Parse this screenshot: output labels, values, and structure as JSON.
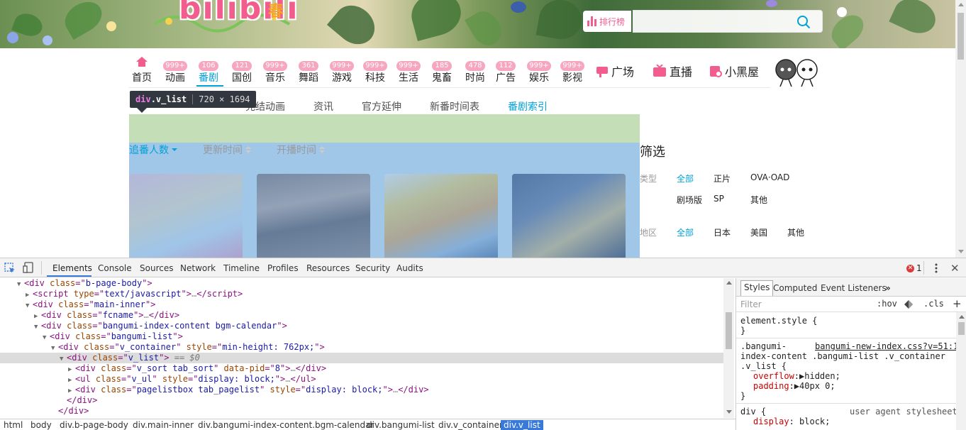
{
  "header": {
    "logo_text": "bilibili",
    "logo_badge": "春",
    "rank_label": "排行榜",
    "search_placeholder": ""
  },
  "nav": {
    "items": [
      {
        "label": "首页",
        "badge": ""
      },
      {
        "label": "动画",
        "badge": "999+"
      },
      {
        "label": "番剧",
        "badge": "106",
        "active": true
      },
      {
        "label": "国创",
        "badge": "121"
      },
      {
        "label": "音乐",
        "badge": "999+"
      },
      {
        "label": "舞蹈",
        "badge": "361"
      },
      {
        "label": "游戏",
        "badge": "999+"
      },
      {
        "label": "科技",
        "badge": "999+"
      },
      {
        "label": "生活",
        "badge": "999+"
      },
      {
        "label": "鬼畜",
        "badge": "185"
      },
      {
        "label": "时尚",
        "badge": "478"
      },
      {
        "label": "广告",
        "badge": "112"
      },
      {
        "label": "娱乐",
        "badge": "999+"
      },
      {
        "label": "影视",
        "badge": "999+"
      }
    ],
    "square": "广场",
    "live": "直播",
    "blackroom": "小黑屋"
  },
  "subtabs": {
    "completed": "完结动画",
    "news": "资讯",
    "official": "官方延伸",
    "schedule": "新番时间表",
    "index": "番剧索引"
  },
  "tooltip": {
    "tag": "div",
    "cls": ".v_list",
    "size": "720 × 1694"
  },
  "sort": {
    "followers": "追番人数",
    "updated": "更新时间",
    "aired": "开播时间"
  },
  "filter": {
    "title": "筛选",
    "type_label": "类型",
    "type_all": "全部",
    "type_tv": "正片",
    "type_ova": "OVA·OAD",
    "type_movie": "剧场版",
    "type_sp": "SP",
    "type_other": "其他",
    "region_label": "地区",
    "region_all": "全部",
    "region_jp": "日本",
    "region_us": "美国",
    "region_other": "其他"
  },
  "devtools": {
    "tabs": [
      "Elements",
      "Console",
      "Sources",
      "Network",
      "Timeline",
      "Profiles",
      "Resources",
      "Security",
      "Audits"
    ],
    "error_count": "1",
    "dom": {
      "l0_attr": "b-page-body",
      "l1_attr": "text/javascript",
      "l2_attr": "main-inner",
      "l3_attr": "fcname",
      "l4_attr": "bangumi-index-content bgm-calendar",
      "l5_attr": "bangumi-list",
      "l6_attr": "v_container",
      "l6_style": "min-height: 762px;",
      "l7_attr": "v_list",
      "l7_eq": "== $0",
      "l8_attr": "v_sort tab_sort",
      "l8_pid": "8",
      "l9_attr": "v_ul",
      "l9_style": "display: block;",
      "l10_attr": "pagelistbox tab_pagelist",
      "l10_style": "display: block;"
    },
    "breadcrumbs": [
      "html",
      "body",
      "div.b-page-body",
      "div.main-inner",
      "div.bangumi-index-content.bgm-calendar",
      "div.bangumi-list",
      "div.v_container",
      "div.v_list"
    ],
    "styles_tabs": [
      "Styles",
      "Computed",
      "Event Listeners"
    ],
    "filter_placeholder": "Filter",
    "hov": ":hov",
    "cls": ".cls",
    "element_style": "element.style {",
    "close_brace": "}",
    "rule_sel1": ".bangumi-",
    "rule_sel2": "index-content .bangumi-list .v_container",
    "rule_sel3": ".v_list {",
    "rule_src": "bangumi-new-index.css?v=51:1",
    "overflow_prop": "overflow",
    "overflow_val": "hidden;",
    "padding_prop": "padding",
    "padding_val": "40px 0;",
    "div_rule": "div {",
    "ua_label": "user agent stylesheet",
    "display_prop": "display",
    "display_val": "block;"
  }
}
